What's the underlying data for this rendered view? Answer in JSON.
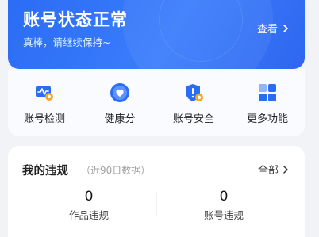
{
  "status_card": {
    "title": "账号状态正常",
    "subtitle": "真棒，请继续保持~",
    "view_label": "查看"
  },
  "tools": [
    {
      "label": "账号检测",
      "icon": "account-check-icon"
    },
    {
      "label": "健康分",
      "icon": "health-score-icon"
    },
    {
      "label": "账号安全",
      "icon": "account-security-icon"
    },
    {
      "label": "更多功能",
      "icon": "more-functions-icon"
    }
  ],
  "violations": {
    "title": "我的违规",
    "subtitle": "（近90日数据）",
    "all_label": "全部",
    "stats": [
      {
        "value": "0",
        "label": "作品违规"
      },
      {
        "value": "0",
        "label": "账号违规"
      }
    ]
  },
  "colors": {
    "accent": "#2b6cf5",
    "accent_light": "#8fb4ff",
    "warning": "#f5a524"
  }
}
